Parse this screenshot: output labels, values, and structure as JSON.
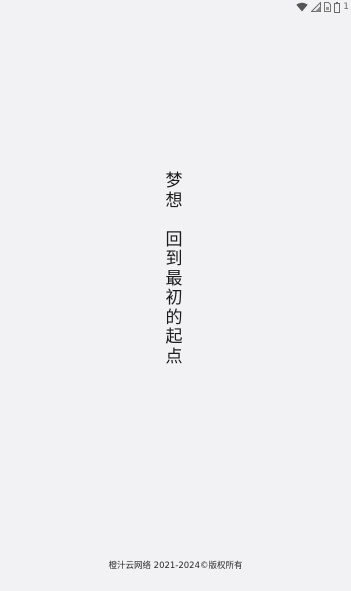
{
  "status_bar": {
    "icons": [
      "wifi-icon",
      "signal-icon",
      "sim-card-icon",
      "battery-icon"
    ],
    "battery_text": "1"
  },
  "splash": {
    "slogan_line1": [
      "梦",
      "想"
    ],
    "slogan_line2": [
      "回",
      "到",
      "最",
      "初",
      "的",
      "起",
      "点"
    ]
  },
  "footer": {
    "copyright": "橙汁云网络 2021-2024©版权所有"
  },
  "colors": {
    "background": "#f2f1f4",
    "text": "#1c1c1c"
  }
}
